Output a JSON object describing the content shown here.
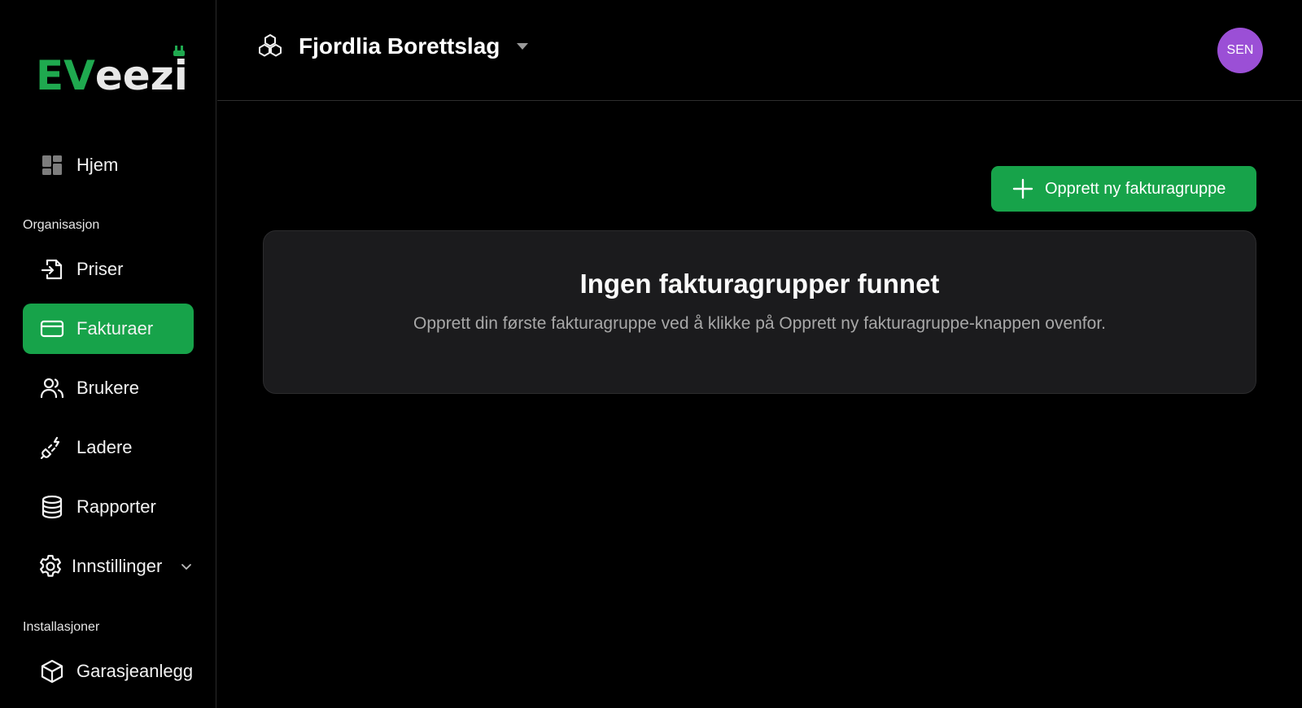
{
  "brand": {
    "part1": "EV",
    "part2": "eezi",
    "accent": "#17a34a"
  },
  "sidebar": {
    "home": {
      "label": "Hjem",
      "icon": "dashboard-icon"
    },
    "section_org": "Organisasjon",
    "items": [
      {
        "label": "Priser",
        "icon": "file-import-icon"
      },
      {
        "label": "Fakturaer",
        "icon": "credit-card-icon",
        "active": true
      },
      {
        "label": "Brukere",
        "icon": "users-icon"
      },
      {
        "label": "Ladere",
        "icon": "ev-plug-icon"
      },
      {
        "label": "Rapporter",
        "icon": "database-icon"
      },
      {
        "label": "Innstillinger",
        "icon": "gear-icon"
      }
    ],
    "section_install": "Installasjoner",
    "install_items": [
      {
        "label": "Garasjeanlegg",
        "icon": "cube-icon"
      }
    ]
  },
  "header": {
    "org_name": "Fjordlia Borettslag",
    "avatar_initials": "SEN",
    "avatar_color": "#9b4fd6"
  },
  "main": {
    "create_button": "Opprett ny fakturagruppe",
    "empty_title": "Ingen fakturagrupper funnet",
    "empty_description": "Opprett din første fakturagruppe ved å klikke på Opprett ny fakturagruppe-knappen ovenfor."
  }
}
